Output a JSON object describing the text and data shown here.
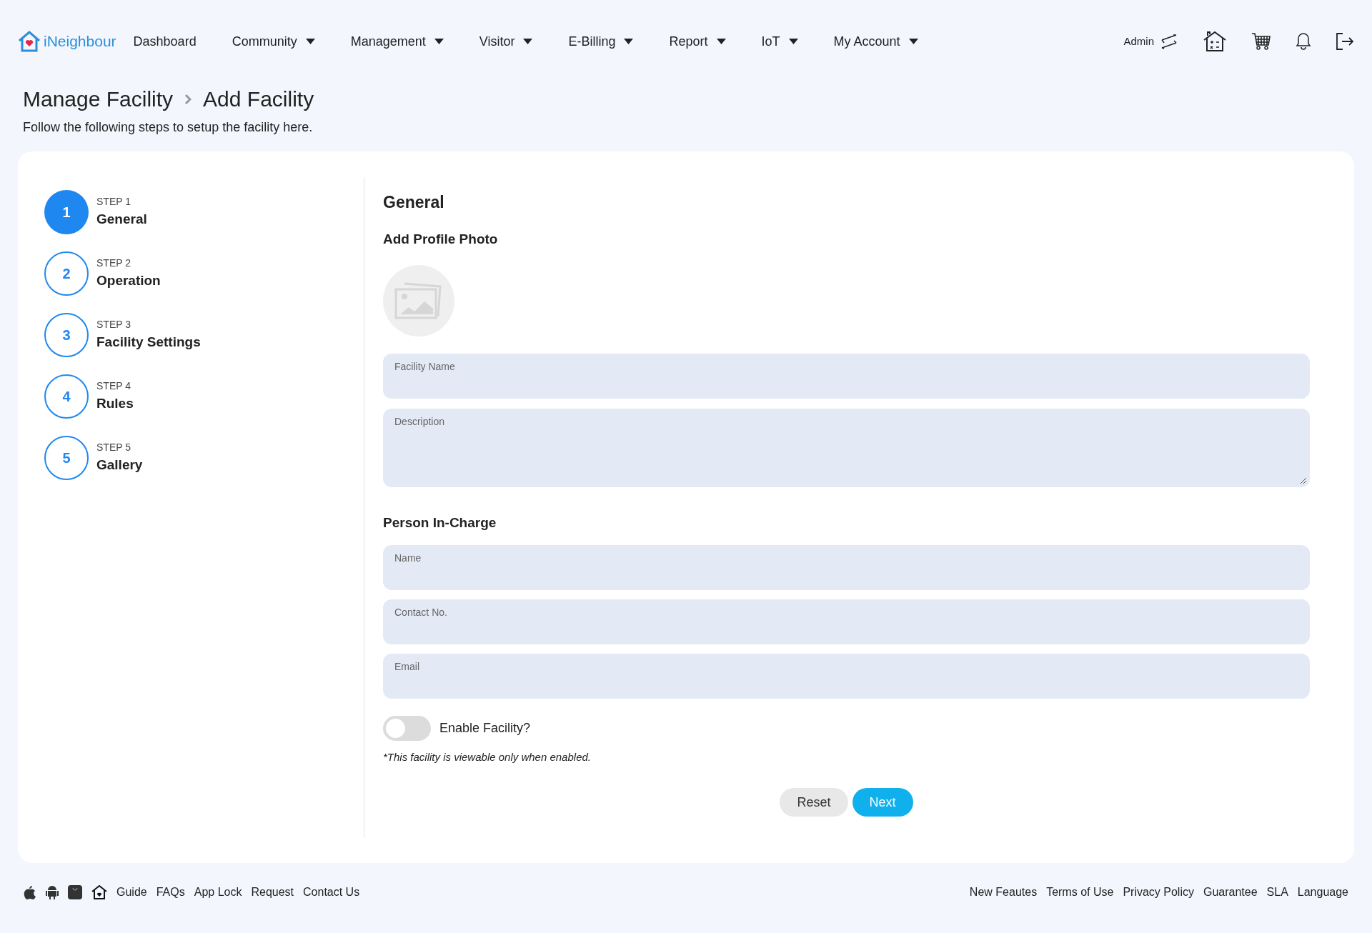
{
  "brand": "iNeighbour",
  "nav": [
    {
      "label": "Dashboard",
      "dropdown": false
    },
    {
      "label": "Community",
      "dropdown": true
    },
    {
      "label": "Management",
      "dropdown": true
    },
    {
      "label": "Visitor",
      "dropdown": true
    },
    {
      "label": "E-Billing",
      "dropdown": true
    },
    {
      "label": "Report",
      "dropdown": true
    },
    {
      "label": "IoT",
      "dropdown": true
    },
    {
      "label": "My Account",
      "dropdown": true
    }
  ],
  "user": "Admin",
  "breadcrumb": [
    "Manage Facility",
    "Add Facility"
  ],
  "subtitle": "Follow the following steps to setup the facility here.",
  "steps": [
    {
      "number": "1",
      "step": "STEP 1",
      "label": "General",
      "selected": true
    },
    {
      "number": "2",
      "step": "STEP 2",
      "label": "Operation",
      "selected": false
    },
    {
      "number": "3",
      "step": "STEP 3",
      "label": "Facility Settings",
      "selected": false
    },
    {
      "number": "4",
      "step": "STEP 4",
      "label": "Rules",
      "selected": false
    },
    {
      "number": "5",
      "step": "STEP 5",
      "label": "Gallery",
      "selected": false
    }
  ],
  "form": {
    "title": "General",
    "photo_heading": "Add Profile Photo",
    "fields": [
      {
        "label": "Facility Name",
        "kind": "input"
      },
      {
        "label": "Description",
        "kind": "textarea"
      }
    ],
    "person_heading": "Person In-Charge",
    "person_fields": [
      {
        "label": "Name"
      },
      {
        "label": "Contact No."
      },
      {
        "label": "Email"
      }
    ],
    "toggle": {
      "label": "Enable Facility?",
      "on": false
    },
    "note": "*This facility is viewable only when enabled.",
    "buttons": [
      {
        "label": "Reset",
        "kind": "secondary"
      },
      {
        "label": "Next",
        "kind": "primary"
      }
    ]
  },
  "footer_left": [
    "Guide",
    "FAQs",
    "App Lock",
    "Request",
    "Contact Us"
  ],
  "footer_right": [
    "New Feautes",
    "Terms of Use",
    "Privacy Policy",
    "Guarantee",
    "SLA",
    "Language"
  ]
}
